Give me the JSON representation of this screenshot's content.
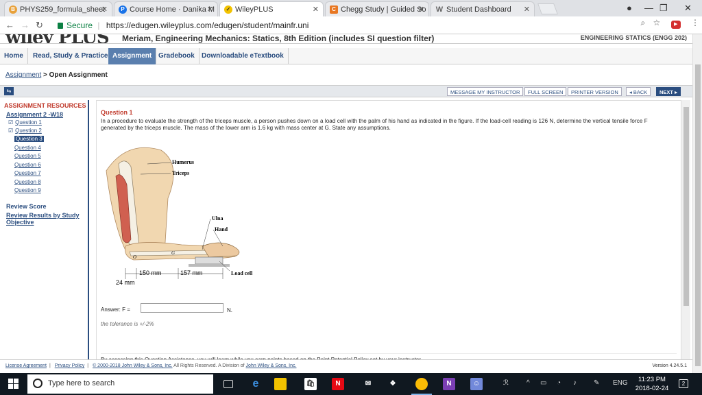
{
  "browser": {
    "tabs": [
      {
        "title": "PHYS259_formula_sheet",
        "icon": "b-circle-icon",
        "color": "#e8a13a"
      },
      {
        "title": "Course Home · Danika M",
        "icon": "p-circle-icon",
        "color": "#1a73e8"
      },
      {
        "title": "WileyPLUS",
        "icon": "wileyplus-icon",
        "color": "#f2c200"
      },
      {
        "title": "Chegg Study | Guided So",
        "icon": "chegg-icon",
        "color": "#e87722"
      },
      {
        "title": "Student Dashboard",
        "icon": "w-icon",
        "color": "#666666"
      }
    ],
    "secure_label": "Secure",
    "url_separator": "|",
    "url": "https://edugen.wileyplus.com/edugen/student/mainfr.uni"
  },
  "course": {
    "logo": "wiley PLUS",
    "title": "Meriam, Engineering Mechanics: Statics, 8th Edition (includes SI question filter)",
    "right_label": "ENGINEERING STATICS (ENGG 202)"
  },
  "nav": {
    "tabs": [
      "Home",
      "Read, Study & Practice",
      "Assignment",
      "Gradebook",
      "Downloadable eTextbook"
    ],
    "active": "Assignment"
  },
  "breadcrumb": {
    "link": "Assignment",
    "separator": ">",
    "current": "Open Assignment"
  },
  "actions": {
    "message": "MESSAGE MY INSTRUCTOR",
    "fullscreen": "FULL SCREEN",
    "printer": "PRINTER VERSION",
    "back": "◂ BACK",
    "next": "NEXT ▸"
  },
  "sidebar": {
    "title": "ASSIGNMENT RESOURCES",
    "assignment": "Assignment 2 -W18",
    "questions": [
      {
        "label": "Question 1",
        "checked": true,
        "current": false
      },
      {
        "label": "Question 2",
        "checked": true,
        "current": false
      },
      {
        "label": "Question 3",
        "checked": false,
        "current": true
      },
      {
        "label": "Question 4",
        "checked": false,
        "current": false
      },
      {
        "label": "Question 5",
        "checked": false,
        "current": false
      },
      {
        "label": "Question 6",
        "checked": false,
        "current": false
      },
      {
        "label": "Question 7",
        "checked": false,
        "current": false
      },
      {
        "label": "Question 8",
        "checked": false,
        "current": false
      },
      {
        "label": "Question 9",
        "checked": false,
        "current": false
      }
    ],
    "review_score": "Review Score",
    "review_results_line1": "Review Results by Study",
    "review_results_line2": "Objective"
  },
  "question": {
    "title": "Question 1",
    "text": "In a procedure to evaluate the strength of the triceps muscle, a person pushes down on a load cell with the palm of his hand as indicated in the figure. If the load-cell reading is 126 N, determine the vertical tensile force F generated by the triceps muscle. The mass of the lower arm is 1.6 kg with mass center at G. State any assumptions.",
    "figure_labels": {
      "humerus": "Humerus",
      "triceps": "Triceps",
      "ulna": "Ulna",
      "hand": "Hand",
      "load_cell": "Load cell",
      "g": "G",
      "o": "O",
      "dim1": "150 mm",
      "dim2": "157 mm",
      "dim3": "24 mm"
    },
    "answer_label": "Answer: F =",
    "answer_value": "",
    "answer_unit": "N.",
    "tolerance": "the tolerance is +/-2%",
    "policy": "By accessing this Question Assistance, you will learn while you earn points based on the Point Potential Policy set by your instructor."
  },
  "footer": {
    "license": "License Agreement",
    "privacy": "Privacy Policy",
    "copyright_link": "© 2000-2018 John Wiley & Sons, Inc.",
    "rights": "All Rights Reserved. A Division of",
    "company": "John Wiley & Sons, Inc.",
    "version": "Version 4.24.5.1"
  },
  "taskbar": {
    "search_placeholder": "Type here to search",
    "language": "ENG",
    "time": "11:23 PM",
    "date": "2018-02-24",
    "notifications": "2"
  }
}
